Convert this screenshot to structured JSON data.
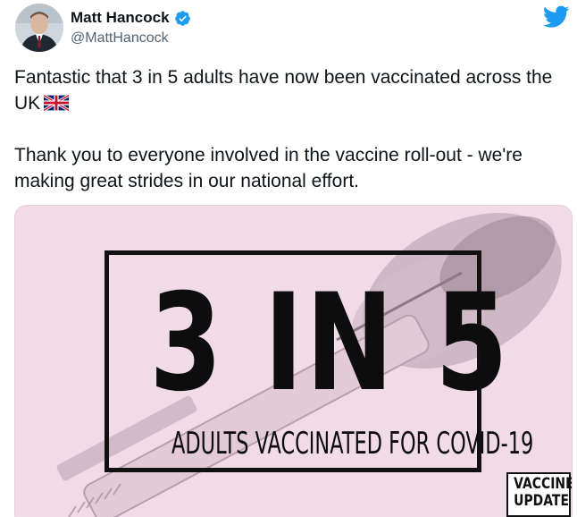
{
  "author": {
    "name": "Matt Hancock",
    "handle": "@MattHancock"
  },
  "tweet": {
    "line1": "Fantastic that 3 in 5 adults have now been vaccinated across the UK",
    "line2": "Thank you to everyone involved in the vaccine roll-out - we're making great strides in our national effort."
  },
  "media": {
    "headline": "3 IN 5",
    "subline": "ADULTS VACCINATED FOR COVID-19",
    "badge_line1": "VACCINE",
    "badge_line2": "UPDATE"
  },
  "icons": {
    "verified": "verified-badge-icon",
    "brand": "twitter-bird-icon",
    "flag": "uk-flag-emoji"
  },
  "colors": {
    "brand_blue": "#1d9bf0",
    "text_primary": "#0f1419",
    "text_secondary": "#536471",
    "media_pink": "#f0dbe7"
  }
}
